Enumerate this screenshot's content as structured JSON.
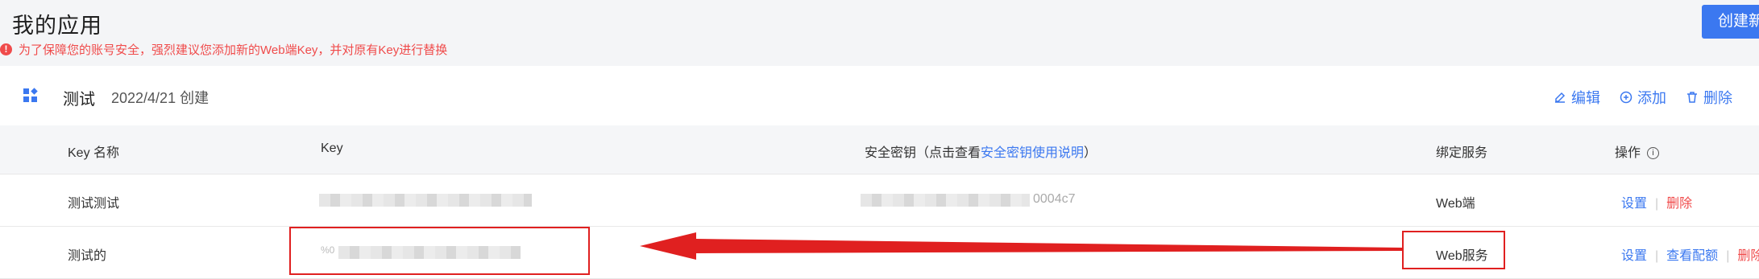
{
  "header": {
    "title": "我的应用",
    "create_button": "创建新应用"
  },
  "warning": {
    "icon": "alert-circle-icon",
    "text": "为了保障您的账号安全，强烈建议您添加新的Web端Key，并对原有Key进行替换"
  },
  "app": {
    "icon": "app-grid-icon",
    "name": "测试",
    "created": "2022/4/21 创建",
    "actions": {
      "edit": "编辑",
      "add": "添加",
      "delete": "删除"
    }
  },
  "table": {
    "headers": {
      "key_name": "Key 名称",
      "key": "Key",
      "secret_prefix": "安全密钥（点击查看",
      "secret_link": "安全密钥使用说明",
      "secret_suffix": "）",
      "service": "绑定服务",
      "ops": "操作"
    },
    "rows": [
      {
        "name": "测试测试",
        "secret_tail": "0004c7",
        "service": "Web端",
        "ops": [
          "设置",
          "删除"
        ]
      },
      {
        "name": "测试的",
        "key_partial": "%0",
        "service": "Web服务",
        "ops": [
          "设置",
          "查看配额",
          "删除"
        ]
      }
    ]
  },
  "colors": {
    "accent": "#3b78f0",
    "danger": "#f04b4b",
    "annotation": "#e02020"
  }
}
